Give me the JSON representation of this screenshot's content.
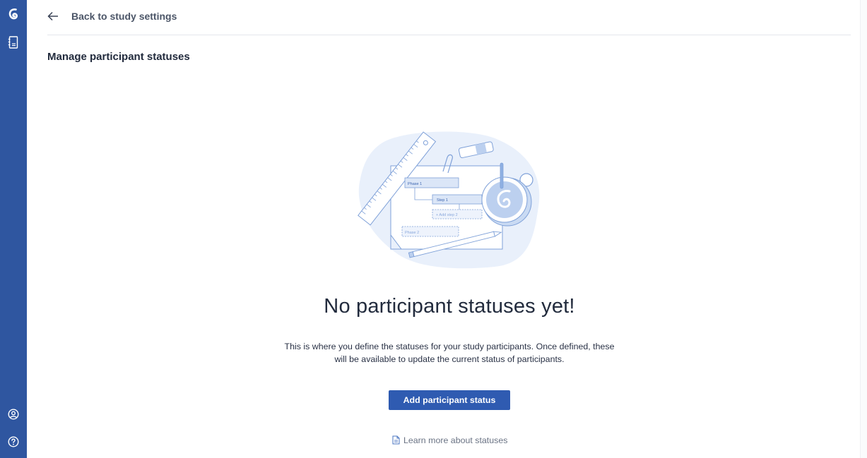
{
  "sidebar": {
    "icons": [
      "logo-icon",
      "notebook-icon",
      "account-icon",
      "help-icon"
    ]
  },
  "header": {
    "back_label": "Back to study settings"
  },
  "page": {
    "title": "Manage participant statuses"
  },
  "illustration": {
    "phase1": "Phase 1",
    "step1": "Step 1",
    "add_step": "+ Add step 2",
    "phase2": "Phase 2"
  },
  "empty_state": {
    "title": "No participant statuses yet!",
    "description_line1": "This is where you define the statuses for your study participants. Once defined, these",
    "description_line2": "will be available to update the current status of participants.",
    "button_label": "Add participant status",
    "link_label": "Learn more about statuses"
  },
  "colors": {
    "sidebar": "#2f56a0",
    "primary": "#2f5bb1",
    "illustration_blob": "#e9f0fb",
    "illustration_accent": "#7ea0d8"
  }
}
